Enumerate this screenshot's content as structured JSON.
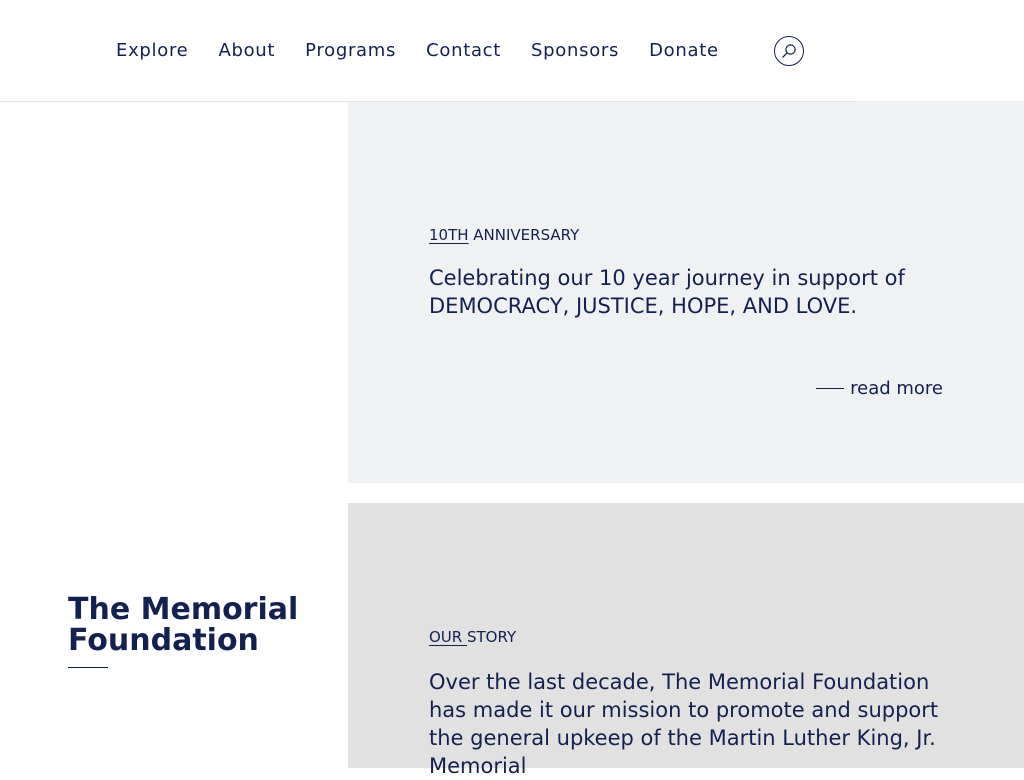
{
  "nav": {
    "items": [
      {
        "label": "Explore"
      },
      {
        "label": "About"
      },
      {
        "label": "Programs"
      },
      {
        "label": "Contact"
      },
      {
        "label": "Sponsors"
      },
      {
        "label": "Donate"
      }
    ],
    "search_icon": "search-icon"
  },
  "anniversary": {
    "eyebrow_underlined": "10TH",
    "eyebrow_rest": " ANNIVERSARY",
    "text": "Celebrating our 10 year journey in support of DEMOCRACY, JUSTICE, HOPE, AND LOVE.",
    "read_more": "read more"
  },
  "brand": {
    "title": "The Memorial Foundation"
  },
  "story": {
    "eyebrow_underlined": "OUR ",
    "eyebrow_rest": "STORY",
    "text": "Over the last decade, The Memorial Foundation has made it our mission to promote and support the general upkeep of the Martin Luther King, Jr. Memorial"
  },
  "colors": {
    "ink": "#14204f",
    "panel_light": "#f0f1f3",
    "panel_gray": "#e1e1e2"
  }
}
